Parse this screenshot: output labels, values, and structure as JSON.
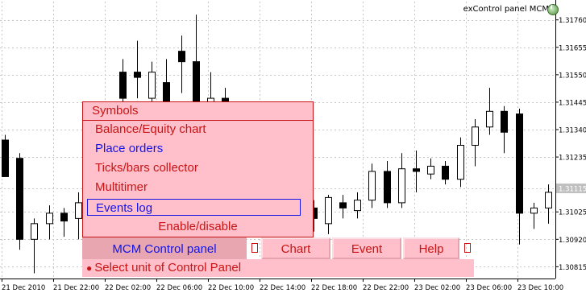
{
  "title": "exControl panel MCM",
  "colors": {
    "bull_candle": "#ffffff",
    "bear_candle": "#000000",
    "menu_bg": "#ffc0cb",
    "menu_text": "#c81414",
    "menu_highlight": "#1414e6",
    "grid": "#c8c8c8",
    "price_tag": "#c0c0c0"
  },
  "price_axis": {
    "labels": [
      "1.31760",
      "1.31655",
      "1.31550",
      "1.31445",
      "1.31340",
      "1.31235",
      "1.31115",
      "1.31025",
      "1.30920",
      "1.30815"
    ],
    "current_price": "1.31115"
  },
  "time_axis": {
    "labels": [
      "21 Dec 2010",
      "21 Dec 22:00",
      "22 Dec 02:00",
      "22 Dec 06:00",
      "22 Dec 10:00",
      "22 Dec 14:00",
      "22 Dec 18:00",
      "22 Dec 22:00",
      "23 Dec 02:00",
      "23 Dec 06:00",
      "23 Dec 10:00"
    ]
  },
  "chart_data": {
    "type": "candlestick",
    "y_range": [
      1.3077,
      1.3183
    ],
    "candles": [
      {
        "o": 1.313,
        "h": 1.3132,
        "l": 1.3116,
        "c": 1.3116
      },
      {
        "o": 1.3123,
        "h": 1.3125,
        "l": 1.3088,
        "c": 1.3092
      },
      {
        "o": 1.3092,
        "h": 1.31,
        "l": 1.3079,
        "c": 1.3098
      },
      {
        "o": 1.3098,
        "h": 1.3105,
        "l": 1.3092,
        "c": 1.3102
      },
      {
        "o": 1.3102,
        "h": 1.3104,
        "l": 1.3093,
        "c": 1.3099
      },
      {
        "o": 1.31,
        "h": 1.311,
        "l": 1.3092,
        "c": 1.3106
      },
      {
        "o": 1.3106,
        "h": 1.3109,
        "l": 1.3102,
        "c": 1.3105
      },
      {
        "o": 1.3105,
        "h": 1.3108,
        "l": 1.309,
        "c": 1.3093
      },
      {
        "o": 1.3156,
        "h": 1.3161,
        "l": 1.314,
        "c": 1.3146
      },
      {
        "o": 1.3156,
        "h": 1.3168,
        "l": 1.3146,
        "c": 1.3154
      },
      {
        "o": 1.3146,
        "h": 1.316,
        "l": 1.3138,
        "c": 1.3156
      },
      {
        "o": 1.3152,
        "h": 1.3161,
        "l": 1.3138,
        "c": 1.3144
      },
      {
        "o": 1.3164,
        "h": 1.317,
        "l": 1.3148,
        "c": 1.316
      },
      {
        "o": 1.316,
        "h": 1.3178,
        "l": 1.3144,
        "c": 1.3144
      },
      {
        "o": 1.3144,
        "h": 1.3156,
        "l": 1.314,
        "c": 1.3146
      },
      {
        "o": 1.3146,
        "h": 1.315,
        "l": 1.3139,
        "c": 1.3143
      },
      {
        "o": 1.31,
        "h": 1.3103,
        "l": 1.3096,
        "c": 1.3104
      },
      {
        "o": 1.3104,
        "h": 1.3112,
        "l": 1.31,
        "c": 1.3106
      },
      {
        "o": 1.3107,
        "h": 1.3113,
        "l": 1.3102,
        "c": 1.3106
      },
      {
        "o": 1.3106,
        "h": 1.3112,
        "l": 1.31,
        "c": 1.3108
      },
      {
        "o": 1.3106,
        "h": 1.311,
        "l": 1.3095,
        "c": 1.3108
      },
      {
        "o": 1.3104,
        "h": 1.3107,
        "l": 1.3095,
        "c": 1.31
      },
      {
        "o": 1.3098,
        "h": 1.3109,
        "l": 1.3094,
        "c": 1.3108
      },
      {
        "o": 1.3106,
        "h": 1.3109,
        "l": 1.31,
        "c": 1.3104
      },
      {
        "o": 1.3103,
        "h": 1.311,
        "l": 1.31,
        "c": 1.3107
      },
      {
        "o": 1.3107,
        "h": 1.3121,
        "l": 1.3104,
        "c": 1.3118
      },
      {
        "o": 1.3118,
        "h": 1.3122,
        "l": 1.3104,
        "c": 1.3106
      },
      {
        "o": 1.3106,
        "h": 1.3125,
        "l": 1.3104,
        "c": 1.3119
      },
      {
        "o": 1.3119,
        "h": 1.3126,
        "l": 1.311,
        "c": 1.3118
      },
      {
        "o": 1.3117,
        "h": 1.3123,
        "l": 1.3115,
        "c": 1.312
      },
      {
        "o": 1.312,
        "h": 1.3122,
        "l": 1.3113,
        "c": 1.3115
      },
      {
        "o": 1.3115,
        "h": 1.3131,
        "l": 1.3112,
        "c": 1.3128
      },
      {
        "o": 1.3128,
        "h": 1.3138,
        "l": 1.312,
        "c": 1.3135
      },
      {
        "o": 1.3135,
        "h": 1.315,
        "l": 1.3132,
        "c": 1.3141
      },
      {
        "o": 1.3141,
        "h": 1.3143,
        "l": 1.3125,
        "c": 1.3133
      },
      {
        "o": 1.314,
        "h": 1.3142,
        "l": 1.309,
        "c": 1.3102
      },
      {
        "o": 1.3102,
        "h": 1.3106,
        "l": 1.3096,
        "c": 1.3104
      },
      {
        "o": 1.3104,
        "h": 1.3113,
        "l": 1.3098,
        "c": 1.311
      }
    ]
  },
  "menu": {
    "header": "Symbols",
    "items": [
      {
        "label": "Balance/Equity chart",
        "color": "#c81414"
      },
      {
        "label": "Place orders",
        "color": "#1414e6"
      },
      {
        "label": "Ticks/bars collector",
        "color": "#c81414"
      },
      {
        "label": "Multitimer",
        "color": "#c81414"
      },
      {
        "label": "Events log",
        "color": "#1414e6"
      }
    ],
    "enable_disable": "Enable/disable"
  },
  "control_bar": {
    "main_label": "MCM Control panel",
    "chart_label": "Chart",
    "event_label": "Event",
    "help_label": "Help"
  },
  "status": {
    "bullet": "●",
    "text": "Select unit of Control Panel"
  }
}
